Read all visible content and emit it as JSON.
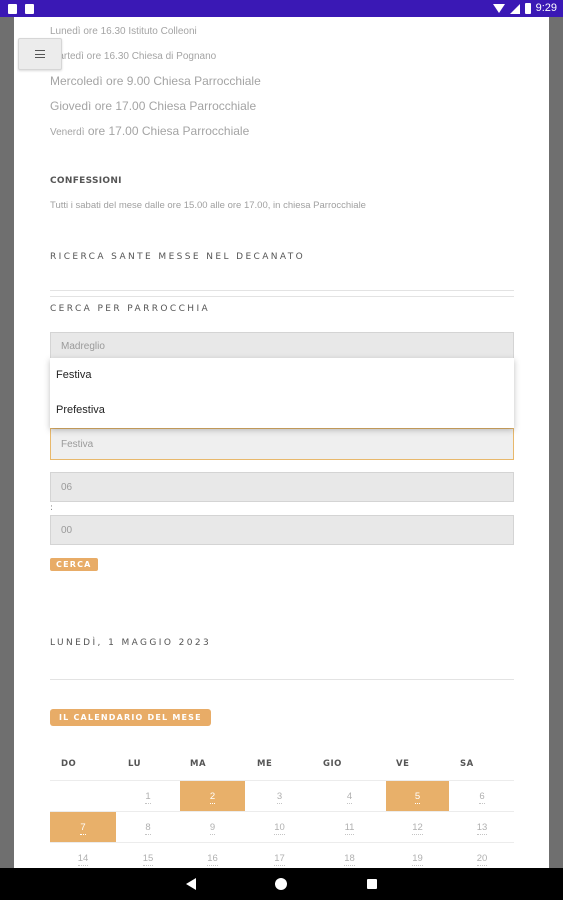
{
  "status_bar": {
    "time": "9:29"
  },
  "schedule": {
    "line1": "Lunedì ore 16.30 Istituto Colleoni",
    "line2": "Martedì ore 16.30 Chiesa di Pognano",
    "line3": "Mercoledì ore 9.00 Chiesa Parrocchiale",
    "line4": "Giovedì ore 17.00 Chiesa Parrocchiale",
    "line5_day": "Venerdì",
    "line5_rest": " ore 17.00 Chiesa Parrocchiale"
  },
  "confessioni": {
    "title": "CONFESSIONI",
    "text": "Tutti i sabati del mese dalle ore 15.00 alle ore 17.00, in chiesa Parrocchiale"
  },
  "search": {
    "decanato_title": "RICERCA SANTE MESSE NEL DECANATO",
    "parish_title": "CERCA PER PARROCCHIA",
    "parish_value": "Madreglio",
    "dropdown_options": [
      "Festiva",
      "Prefestiva"
    ],
    "type_value": "Festiva",
    "hour_value": "06",
    "colon": ":",
    "minute_value": "00",
    "button_label": "CERCA"
  },
  "date_title": "LUNEDÌ, 1 MAGGIO 2023",
  "calendar": {
    "button_label": "IL CALENDARIO DEL MESE",
    "weekdays": [
      "DO",
      "LU",
      "MA",
      "ME",
      "GIO",
      "VE",
      "SA"
    ],
    "rows": [
      [
        "",
        "1",
        "2",
        "3",
        "4",
        "5",
        "6"
      ],
      [
        "7",
        "8",
        "9",
        "10",
        "11",
        "12",
        "13"
      ],
      [
        "14",
        "15",
        "16",
        "17",
        "18",
        "19",
        "20"
      ]
    ],
    "highlighted_days": [
      "2",
      "5",
      "7"
    ],
    "highlight_color": "#e8b06a"
  },
  "colors": {
    "accent": "#e8ac67",
    "status_bar": "#3a18b5"
  }
}
